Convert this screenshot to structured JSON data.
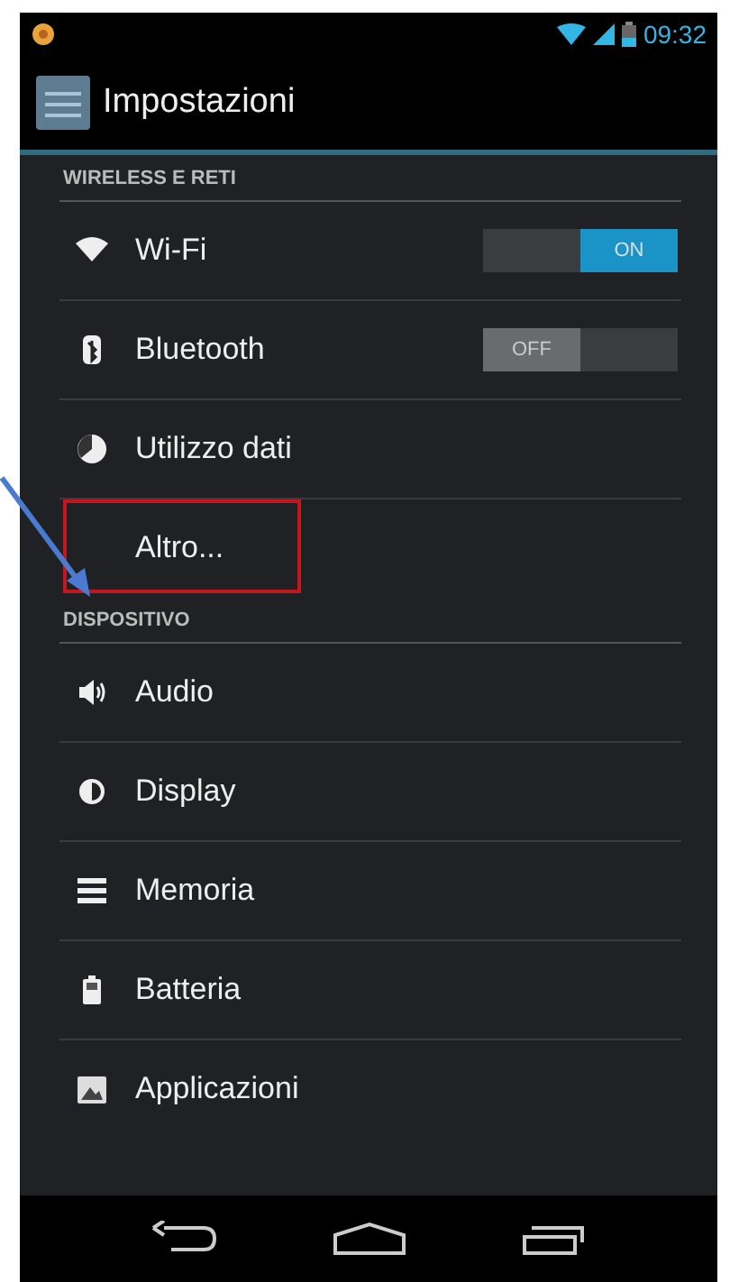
{
  "status_bar": {
    "time": "09:32"
  },
  "action_bar": {
    "title": "Impostazioni"
  },
  "sections": [
    {
      "header": "WIRELESS E RETI",
      "items": [
        {
          "kind": "toggle",
          "label": "Wi-Fi",
          "on": true,
          "switch_label": "ON",
          "highlighted": false
        },
        {
          "kind": "toggle",
          "label": "Bluetooth",
          "on": false,
          "switch_label": "OFF",
          "highlighted": false
        },
        {
          "kind": "item",
          "label": "Utilizzo dati",
          "highlighted": false
        },
        {
          "kind": "item",
          "label": "Altro...",
          "highlighted": true
        }
      ]
    },
    {
      "header": "DISPOSITIVO",
      "items": [
        {
          "kind": "item",
          "label": "Audio",
          "highlighted": false
        },
        {
          "kind": "item",
          "label": "Display",
          "highlighted": false
        },
        {
          "kind": "item",
          "label": "Memoria",
          "highlighted": false
        },
        {
          "kind": "item",
          "label": "Batteria",
          "highlighted": false
        },
        {
          "kind": "item",
          "label": "Applicazioni",
          "highlighted": false
        }
      ]
    }
  ]
}
